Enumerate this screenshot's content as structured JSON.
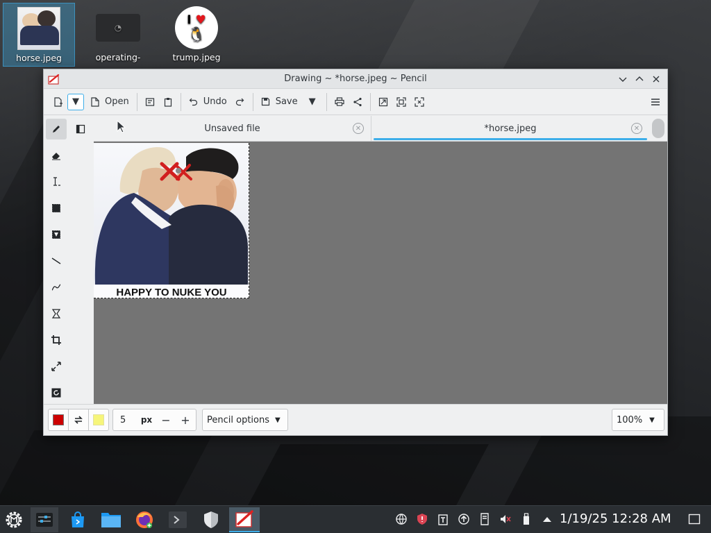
{
  "desktop": {
    "icons": [
      {
        "label": "horse.jpeg",
        "icon": "photo-thumbnail-icon"
      },
      {
        "label": "operating-",
        "icon": "dark-file-icon"
      },
      {
        "label": "trump.jpeg",
        "icon": "i-love-linux-icon"
      }
    ],
    "trump_thumb": {
      "line1": "I",
      "heart": "♥",
      "tux": "🐧"
    }
  },
  "window": {
    "title": "Drawing ~ *horse.jpeg ~ Pencil",
    "controls": [
      "minimize",
      "maximize",
      "close"
    ]
  },
  "toolbar": {
    "open_label": "Open",
    "undo_label": "Undo",
    "save_label": "Save"
  },
  "tabs": [
    {
      "label": "Unsaved file",
      "active": false
    },
    {
      "label": "*horse.jpeg",
      "active": true
    }
  ],
  "tools": [
    "pencil",
    "eraser",
    "text",
    "rectangle-selection",
    "free-selection",
    "line",
    "curve",
    "shape",
    "crop",
    "scale",
    "rotate"
  ],
  "image": {
    "caption": "HAPPY TO NUKE YOU"
  },
  "options": {
    "primary_color": "#cc0000",
    "secondary_color": "#f6f57a",
    "size_value": "5",
    "size_unit": "px",
    "minus": "−",
    "plus": "+",
    "tool_options_label": "Pencil options",
    "zoom_label": "100%"
  },
  "taskbar": {
    "clock": "1/19/25 12:28 AM",
    "apps": [
      "app-launcher",
      "system-settings",
      "discover",
      "dolphin",
      "firefox",
      "terminal",
      "shield",
      "drawing"
    ]
  },
  "colors": {
    "accent": "#3daee9",
    "canvas_bg": "#747474",
    "taskbar_bg": "#2a2e32"
  }
}
